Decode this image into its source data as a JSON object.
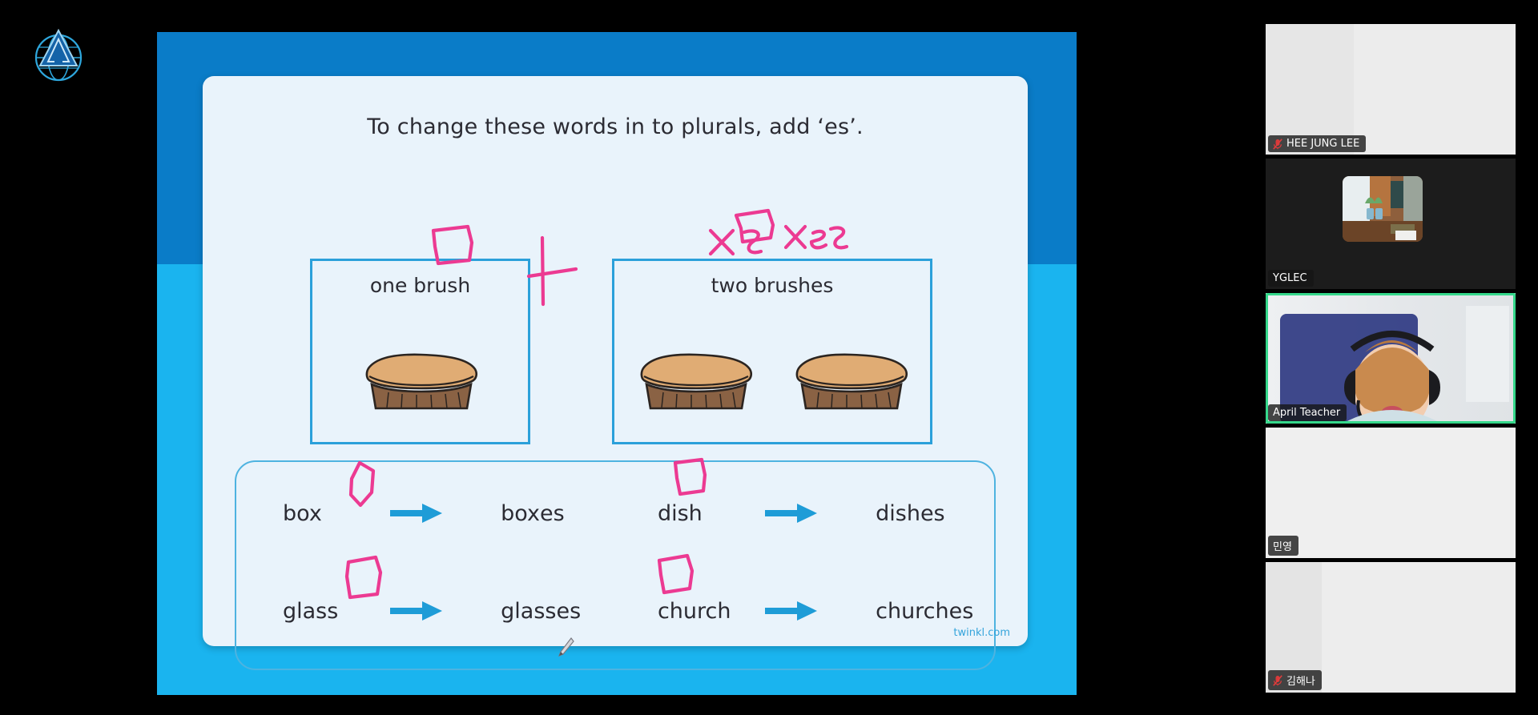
{
  "app": {
    "background_color": "#000000",
    "logo_name": "academy-globe-logo"
  },
  "slide": {
    "title": "To change these words in to plurals, add ‘es’.",
    "background_top_color": "#0a7cc8",
    "background_bottom_color": "#1ab4ef",
    "card_color": "#e9f3fb",
    "accent_color": "#2ba0da",
    "ink_color": "#ec3a92",
    "watermark": "twinkl.com",
    "comparison": {
      "left_label": "one brush",
      "right_label": "two brushes",
      "left_image": "paint-brush-illustration",
      "right_images": [
        "paint-brush-illustration",
        "paint-brush-illustration"
      ]
    },
    "word_rows": [
      [
        {
          "singular": "box",
          "plural_stem": "box",
          "plural_suffix": "es",
          "arrow": "right-arrow-icon"
        },
        {
          "singular": "dish",
          "plural_stem": "dish",
          "plural_suffix": "es",
          "arrow": "right-arrow-icon"
        }
      ],
      [
        {
          "singular": "glass",
          "plural_stem": "glass",
          "plural_suffix": "es",
          "arrow": "right-arrow-icon"
        },
        {
          "singular": "church",
          "plural_stem": "church",
          "plural_suffix": "es",
          "arrow": "right-arrow-icon"
        }
      ]
    ],
    "annotations": {
      "ink_marks": [
        "circle-around-sh-in-one-brush",
        "circle-around-es-in-two-brushes",
        "plus-sign-between-boxes",
        "handwritten-x-s",
        "handwritten-x-es",
        "circle-around-x-in-box",
        "circle-around-sh-in-dish",
        "circle-around-ss-in-glass",
        "circle-around-ch-in-church"
      ],
      "handwritten_left": "x s",
      "handwritten_right": "x es",
      "cursor": "pencil-cursor"
    }
  },
  "participants": [
    {
      "name": "HEE JUNG LEE",
      "muted": true,
      "active_speaker": false,
      "video": "blank-white-room"
    },
    {
      "name": "YGLEC",
      "muted": false,
      "active_speaker": false,
      "video": "room-window-plants-photo"
    },
    {
      "name": "April Teacher",
      "muted": false,
      "active_speaker": true,
      "video": "teacher-with-headset"
    },
    {
      "name": "민영",
      "muted": false,
      "active_speaker": false,
      "video": "blank-light-room"
    },
    {
      "name": "김해나",
      "muted": true,
      "active_speaker": false,
      "video": "blank-light-room"
    }
  ]
}
